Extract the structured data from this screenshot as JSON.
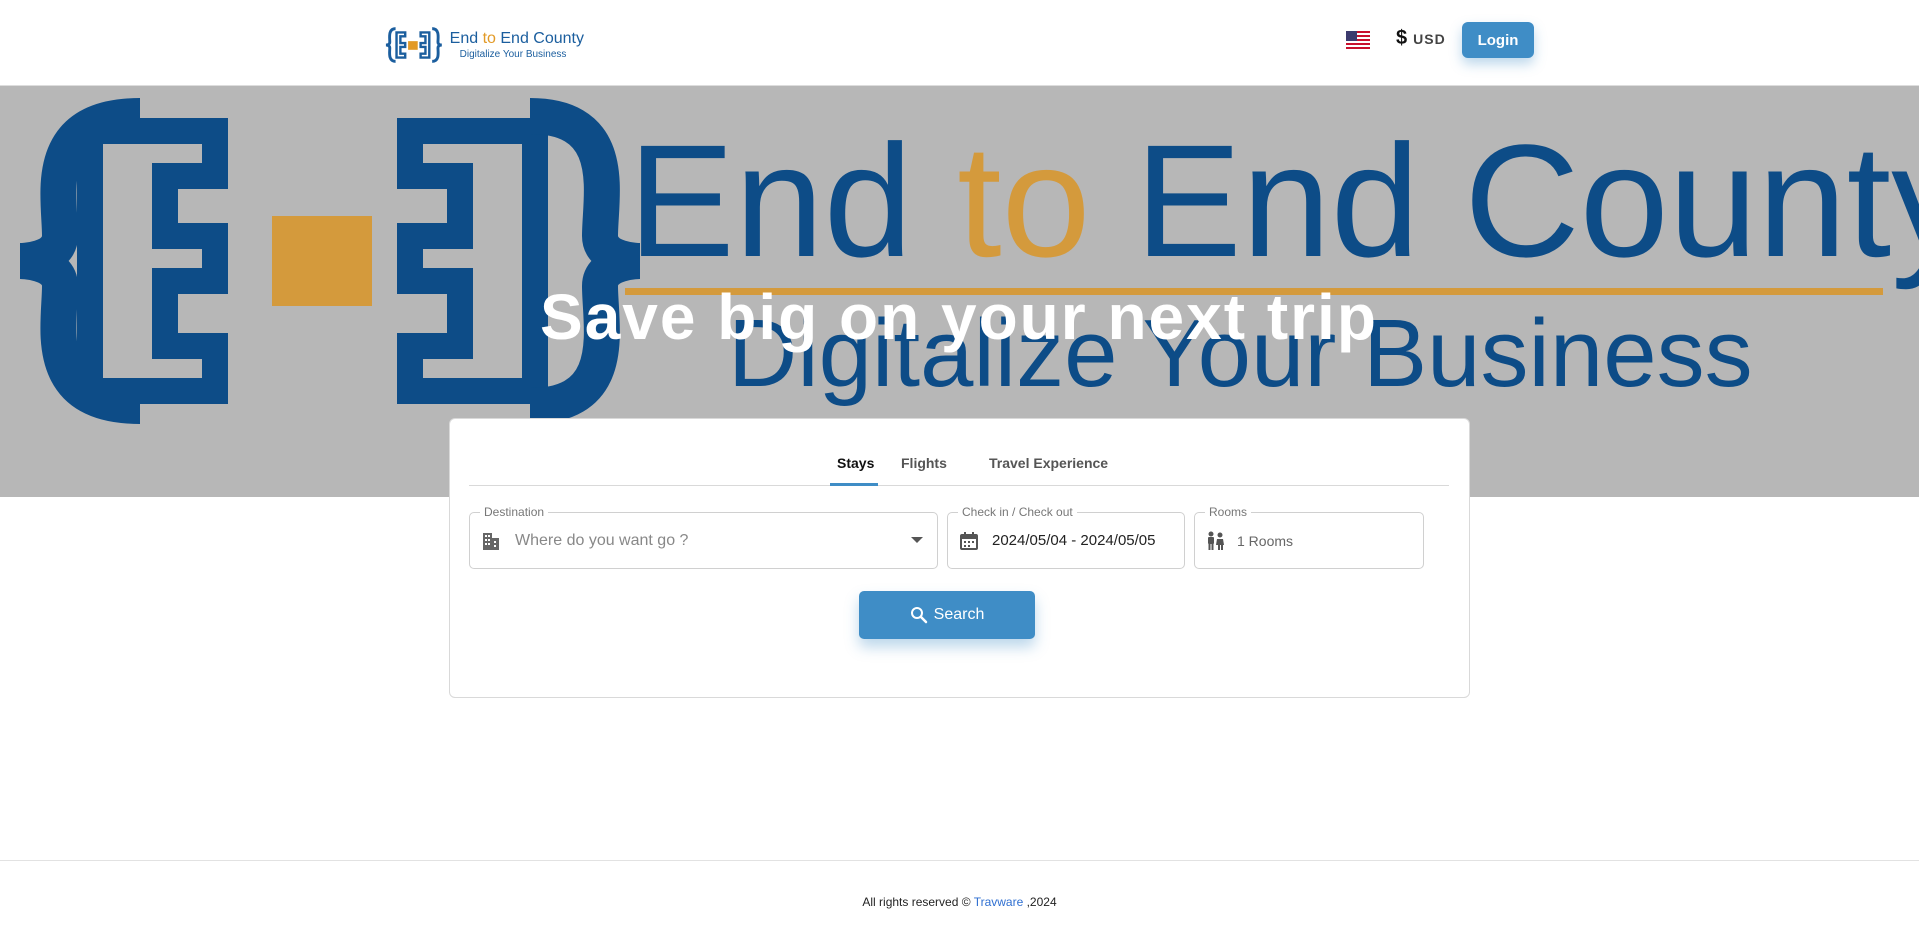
{
  "header": {
    "logo_title_part1": "End ",
    "logo_title_to": "to",
    "logo_title_part2": " End County",
    "logo_subtitle": "Digitalize Your Business",
    "currency_symbol": "$",
    "currency_code": "USD",
    "login_label": "Login"
  },
  "hero": {
    "title": "Save big on your next trip",
    "bg_title_part1": "End ",
    "bg_title_to": "to",
    "bg_title_part2": " End County",
    "bg_subtitle": "Digitalize Your Business"
  },
  "search": {
    "tabs": [
      {
        "label": "Stays"
      },
      {
        "label": "Flights"
      },
      {
        "label": "Travel Experience"
      }
    ],
    "destination": {
      "label": "Destination",
      "placeholder": "Where do you want go ?"
    },
    "dates": {
      "label": "Check in / Check out",
      "value": "2024/05/04 - 2024/05/05"
    },
    "rooms": {
      "label": "Rooms",
      "value": "1 Rooms"
    },
    "search_label": "Search"
  },
  "footer": {
    "text_before": "All rights reserved © ",
    "link": "Travware",
    "text_after": " ,2024"
  },
  "colors": {
    "accent": "#3f8dc6",
    "brand_blue": "#1b5e9e",
    "brand_orange": "#e29a27",
    "hero_bg": "#b7b7b7"
  }
}
